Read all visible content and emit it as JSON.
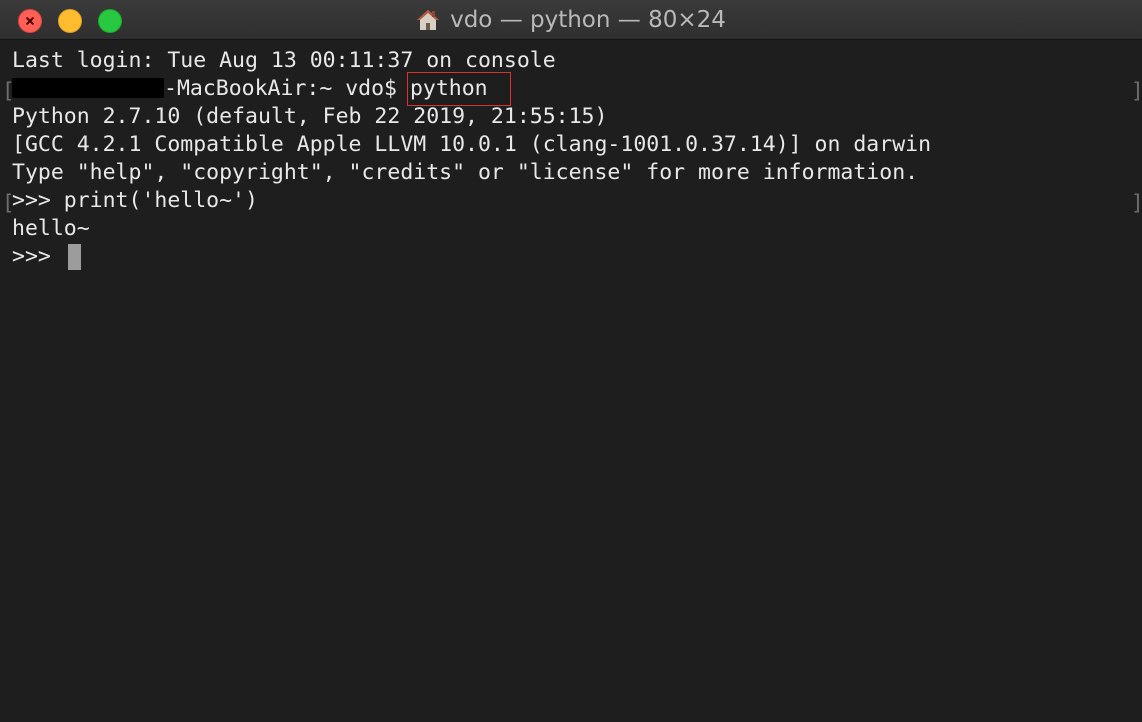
{
  "window": {
    "title": "vdo — python — 80×24"
  },
  "terminal": {
    "lines": {
      "last_login": "Last login: Tue Aug 13 00:11:37 on console",
      "prompt_host_suffix": "-MacBookAir:~ vdo$ ",
      "command": "python",
      "python_version": "Python 2.7.10 (default, Feb 22 2019, 21:55:15)",
      "gcc_info": "[GCC 4.2.1 Compatible Apple LLVM 10.0.1 (clang-1001.0.37.14)] on darwin",
      "help_hint": "Type \"help\", \"copyright\", \"credits\" or \"license\" for more information.",
      "repl_input": ">>> print('hello~')",
      "repl_output": "hello~",
      "repl_prompt": ">>> "
    },
    "brackets": {
      "open": "[",
      "close": "]"
    }
  },
  "colors": {
    "background": "#1e1e1e",
    "text": "#e8e8e8",
    "highlight_box": "#d8332c",
    "cursor": "#9c9c9c",
    "traffic_close": "#fe5f57",
    "traffic_minimize": "#febc2e",
    "traffic_zoom": "#28c840"
  },
  "icons": {
    "title": "home-icon",
    "close": "close-icon"
  }
}
